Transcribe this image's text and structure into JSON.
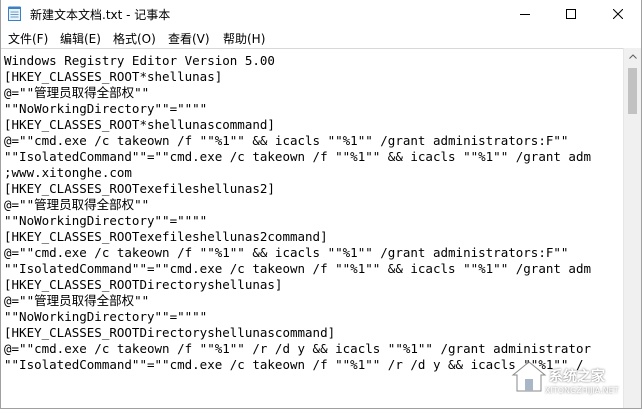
{
  "window": {
    "title": "新建文本文档.txt - 记事本",
    "controls": {
      "minimize_icon": "minimize-icon",
      "maximize_icon": "maximize-icon",
      "close_icon": "close-icon"
    }
  },
  "menu": [
    {
      "label": "文件(F)"
    },
    {
      "label": "编辑(E)"
    },
    {
      "label": "格式(O)"
    },
    {
      "label": "查看(V)"
    },
    {
      "label": "帮助(H)"
    }
  ],
  "editor": {
    "lines": [
      "Windows Registry Editor Version 5.00",
      "[HKEY_CLASSES_ROOT*shellunas]",
      "@=\"\"管理员取得全部权\"\"",
      "\"\"NoWorkingDirectory\"\"=\"\"\"\"",
      "[HKEY_CLASSES_ROOT*shellunascommand]",
      "@=\"\"cmd.exe /c takeown /f \"\"%1\"\" && icacls \"\"%1\"\" /grant administrators:F\"\"",
      "\"\"IsolatedCommand\"\"=\"\"cmd.exe /c takeown /f \"\"%1\"\" && icacls \"\"%1\"\" /grant adm",
      ";www.xitonghe.com",
      "[HKEY_CLASSES_ROOTexefileshellunas2]",
      "@=\"\"管理员取得全部权\"\"",
      "\"\"NoWorkingDirectory\"\"=\"\"\"\"",
      "[HKEY_CLASSES_ROOTexefileshellunas2command]",
      "@=\"\"cmd.exe /c takeown /f \"\"%1\"\" && icacls \"\"%1\"\" /grant administrators:F\"\"",
      "\"\"IsolatedCommand\"\"=\"\"cmd.exe /c takeown /f \"\"%1\"\" && icacls \"\"%1\"\" /grant adm",
      "[HKEY_CLASSES_ROOTDirectoryshellunas]",
      "@=\"\"管理员取得全部权\"\"",
      "\"\"NoWorkingDirectory\"\"=\"\"\"\"",
      "[HKEY_CLASSES_ROOTDirectoryshellunascommand]",
      "@=\"\"cmd.exe /c takeown /f \"\"%1\"\" /r /d y && icacls \"\"%1\"\" /grant administrator",
      "\"\"IsolatedCommand\"\"=\"\"cmd.exe /c takeown /f \"\"%1\"\" /r /d y && icacls \"\"%1\"\" /"
    ]
  },
  "watermark": {
    "name": "系统之家",
    "url": "XITONGZHIJIA.NET"
  },
  "colors": {
    "background": "#ffffff",
    "text": "#000000",
    "scrollbar": "#f0f0f0",
    "thumb": "#c2c2c2"
  }
}
